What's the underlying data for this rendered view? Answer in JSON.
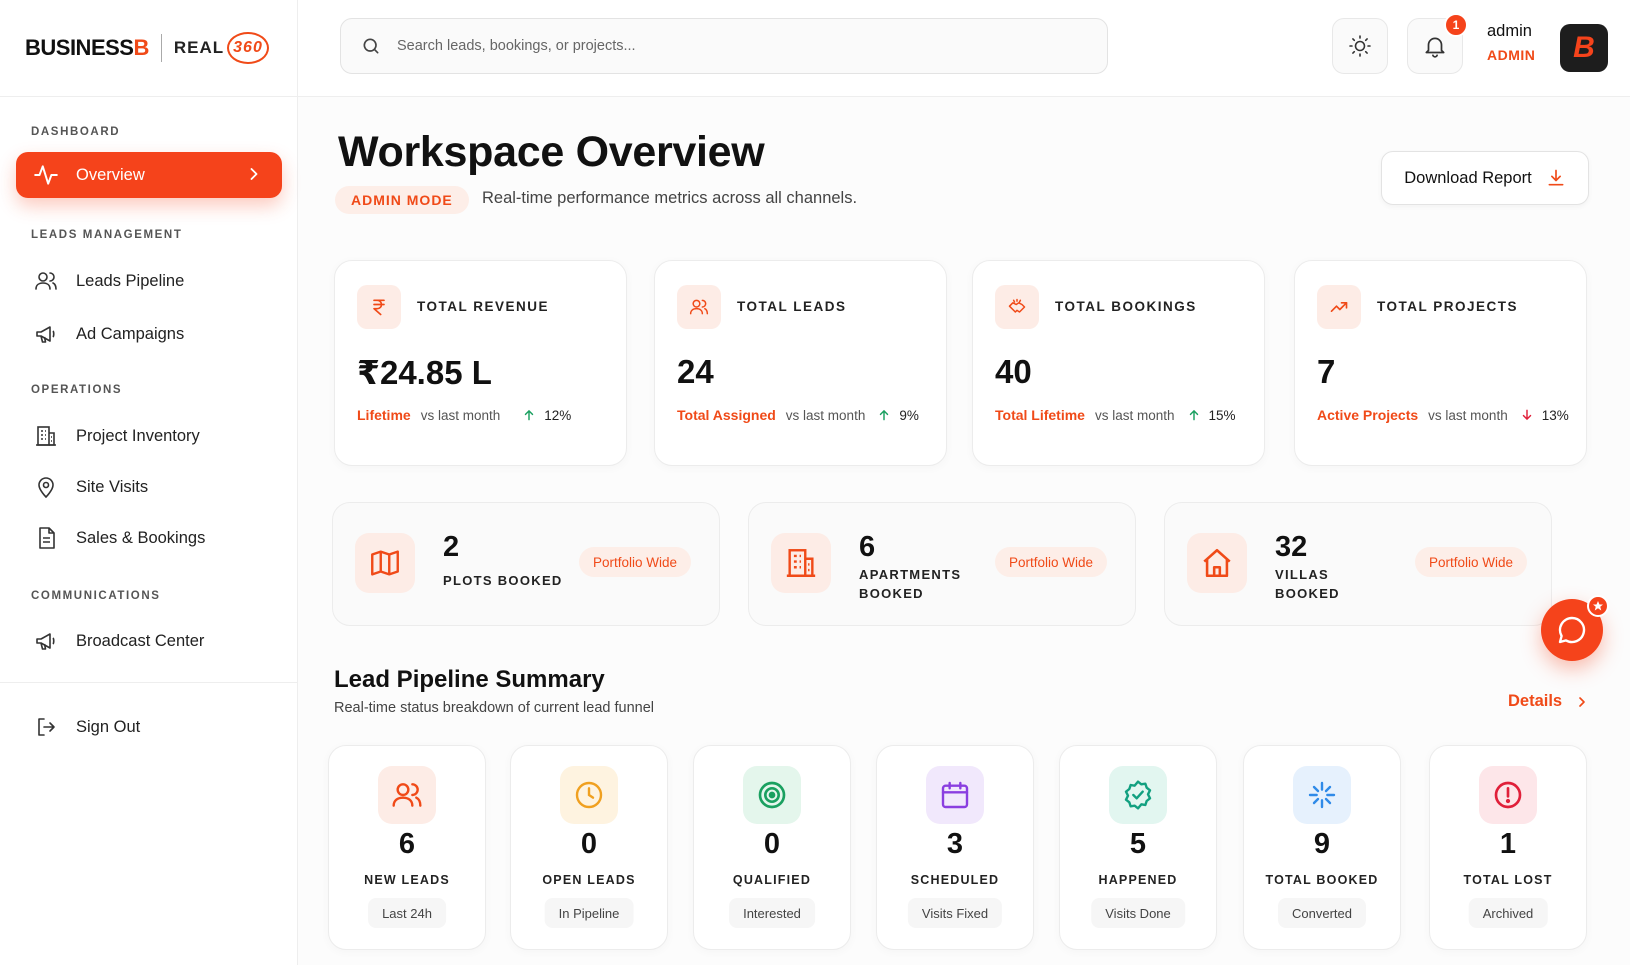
{
  "brand": {
    "business_prefix": "BUSINESS",
    "business_suffix": "B",
    "real": "REAL",
    "num": "360",
    "avatar_letter": "B"
  },
  "sidebar": {
    "sections": [
      "DASHBOARD",
      "LEADS MANAGEMENT",
      "OPERATIONS",
      "COMMUNICATIONS"
    ],
    "items": [
      {
        "label": "Overview",
        "icon": "pulse-icon",
        "active": true
      },
      {
        "label": "Leads Pipeline",
        "icon": "users-icon"
      },
      {
        "label": "Ad Campaigns",
        "icon": "megaphone-icon"
      },
      {
        "label": "Project Inventory",
        "icon": "building-icon"
      },
      {
        "label": "Site Visits",
        "icon": "map-pin-icon"
      },
      {
        "label": "Sales & Bookings",
        "icon": "document-icon"
      },
      {
        "label": "Broadcast Center",
        "icon": "megaphone-icon"
      }
    ],
    "sign_out": "Sign Out"
  },
  "header": {
    "search_placeholder": "Search leads, bookings, or projects...",
    "notification_count": "1",
    "user_name": "admin",
    "user_role": "ADMIN"
  },
  "main": {
    "title": "Workspace Overview",
    "mode": "ADMIN MODE",
    "subtitle": "Real-time performance metrics across all channels.",
    "download_label": "Download Report"
  },
  "stats": [
    {
      "label": "TOTAL REVENUE",
      "value": "₹24.85 L",
      "tag": "Lifetime",
      "vs": "vs last month",
      "pct": "12%",
      "trend": "up"
    },
    {
      "label": "TOTAL LEADS",
      "value": "24",
      "tag": "Total Assigned",
      "vs": "vs last month",
      "pct": "9%",
      "trend": "up"
    },
    {
      "label": "TOTAL BOOKINGS",
      "value": "40",
      "tag": "Total Lifetime",
      "vs": "vs last month",
      "pct": "15%",
      "trend": "up"
    },
    {
      "label": "TOTAL PROJECTS",
      "value": "7",
      "tag": "Active Projects",
      "vs": "vs last month",
      "pct": "13%",
      "trend": "down"
    }
  ],
  "units": [
    {
      "value": "2",
      "label": "PLOTS BOOKED",
      "pill": "Portfolio Wide"
    },
    {
      "value": "6",
      "label": "APARTMENTS BOOKED",
      "pill": "Portfolio Wide"
    },
    {
      "value": "32",
      "label": "VILLAS BOOKED",
      "pill": "Portfolio Wide"
    }
  ],
  "pipeline": {
    "title": "Lead Pipeline Summary",
    "subtitle": "Real-time status breakdown of current lead funnel",
    "details_label": "Details",
    "items": [
      {
        "value": "6",
        "label": "NEW LEADS",
        "sub": "Last 24h",
        "color": "#f04a18"
      },
      {
        "value": "0",
        "label": "OPEN LEADS",
        "sub": "In Pipeline",
        "color": "#f0a020"
      },
      {
        "value": "0",
        "label": "QUALIFIED",
        "sub": "Interested",
        "color": "#1aa060"
      },
      {
        "value": "3",
        "label": "SCHEDULED",
        "sub": "Visits Fixed",
        "color": "#8a3ee0"
      },
      {
        "value": "5",
        "label": "HAPPENED",
        "sub": "Visits Done",
        "color": "#12a080"
      },
      {
        "value": "9",
        "label": "TOTAL BOOKED",
        "sub": "Converted",
        "color": "#2f8ae8"
      },
      {
        "value": "1",
        "label": "TOTAL LOST",
        "sub": "Archived",
        "color": "#e0203a"
      }
    ]
  }
}
